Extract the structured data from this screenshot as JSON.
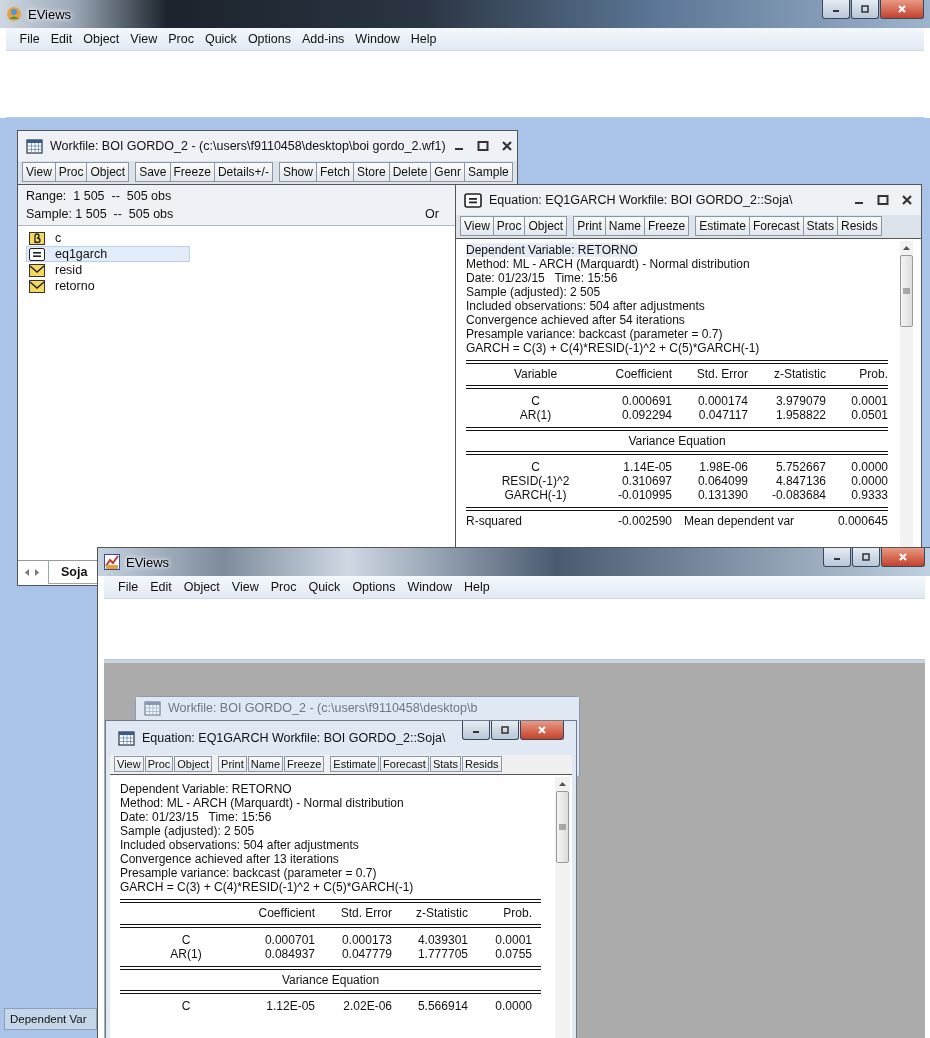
{
  "top_app": {
    "title": "EViews",
    "menu": [
      "File",
      "Edit",
      "Object",
      "View",
      "Proc",
      "Quick",
      "Options",
      "Add-ins",
      "Window",
      "Help"
    ]
  },
  "workfile_window": {
    "title": "Workfile: BOI GORDO_2 - (c:\\users\\f9110458\\desktop\\boi gordo_2.wf1)",
    "toolbar": [
      [
        "View",
        "Proc",
        "Object"
      ],
      [
        "Save",
        "Freeze",
        "Details+/-"
      ],
      [
        "Show",
        "Fetch",
        "Store",
        "Delete",
        "Genr",
        "Sample"
      ]
    ],
    "range": "Range:  1 505  --  505 obs",
    "sample": "Sample: 1 505  --  505 obs",
    "order": "Or",
    "objects": [
      {
        "name": "c",
        "kind": "coef",
        "selected": false
      },
      {
        "name": "eq1garch",
        "kind": "equation",
        "selected": true
      },
      {
        "name": "resid",
        "kind": "series",
        "selected": false
      },
      {
        "name": "retorno",
        "kind": "series",
        "selected": false
      }
    ],
    "tabs": [
      {
        "label": "Soja",
        "selected": true
      }
    ]
  },
  "equation_window": {
    "title": "Equation: EQ1GARCH   Workfile: BOI GORDO_2::Soja\\",
    "toolbar": [
      [
        "View",
        "Proc",
        "Object"
      ],
      [
        "Print",
        "Name",
        "Freeze"
      ],
      [
        "Estimate",
        "Forecast",
        "Stats",
        "Resids"
      ]
    ],
    "header_lines": [
      "Dependent Variable: RETORNO",
      "Method: ML - ARCH (Marquardt) - Normal distribution",
      "Date: 01/23/15   Time: 15:56",
      "Sample (adjusted): 2 505",
      "Included observations: 504 after adjustments",
      "Convergence achieved after 54 iterations",
      "Presample variance: backcast (parameter = 0.7)",
      "GARCH = C(3) + C(4)*RESID(-1)^2 + C(5)*GARCH(-1)"
    ],
    "columns": [
      "Variable",
      "Coefficient",
      "Std. Error",
      "z-Statistic",
      "Prob."
    ],
    "rows": [
      [
        "C",
        "0.000691",
        "0.000174",
        "3.979079",
        "0.0001"
      ],
      [
        "AR(1)",
        "0.092294",
        "0.047117",
        "1.958822",
        "0.0501"
      ]
    ],
    "variance_title": "Variance Equation",
    "variance_rows": [
      [
        "C",
        "1.14E-05",
        "1.98E-06",
        "5.752667",
        "0.0000"
      ],
      [
        "RESID(-1)^2",
        "0.310697",
        "0.064099",
        "4.847136",
        "0.0000"
      ],
      [
        "GARCH(-1)",
        "-0.010995",
        "0.131390",
        "-0.083684",
        "0.9333"
      ]
    ],
    "stats_rows": [
      [
        "R-squared",
        "-0.002590",
        "Mean dependent var",
        "0.000645"
      ]
    ]
  },
  "partial_panel": {
    "text": "Dependent Var"
  },
  "bottom_app": {
    "title": "EViews",
    "menu": [
      "File",
      "Edit",
      "Object",
      "View",
      "Proc",
      "Quick",
      "Options",
      "Window",
      "Help"
    ]
  },
  "background_window": {
    "title": "Workfile: BOI GORDO_2 - (c:\\users\\f9110458\\desktop\\b"
  },
  "bottom_equation_window": {
    "title": "Equation: EQ1GARCH   Workfile: BOI GORDO_2::Soja\\",
    "toolbar": [
      [
        "View",
        "Proc",
        "Object"
      ],
      [
        "Print",
        "Name",
        "Freeze"
      ],
      [
        "Estimate",
        "Forecast",
        "Stats",
        "Resids"
      ]
    ],
    "header_lines": [
      "Dependent Variable: RETORNO",
      "Method: ML - ARCH (Marquardt) - Normal distribution",
      "Date: 01/23/15   Time: 15:56",
      "Sample (adjusted): 2 505",
      "Included observations: 504 after adjustments",
      "Convergence achieved after 13 iterations",
      "Presample variance: backcast (parameter = 0.7)",
      "GARCH = C(3) + C(4)*RESID(-1)^2 + C(5)*GARCH(-1)"
    ],
    "columns": [
      "",
      "Coefficient",
      "Std. Error",
      "z-Statistic",
      "Prob."
    ],
    "rows": [
      [
        "C",
        "0.000701",
        "0.000173",
        "4.039301",
        "0.0001"
      ],
      [
        "AR(1)",
        "0.084937",
        "0.047779",
        "1.777705",
        "0.0755"
      ]
    ],
    "variance_title": "Variance Equation",
    "variance_rows": [
      [
        "C",
        "1.12E-05",
        "2.02E-06",
        "5.566914",
        "0.0000"
      ]
    ]
  }
}
